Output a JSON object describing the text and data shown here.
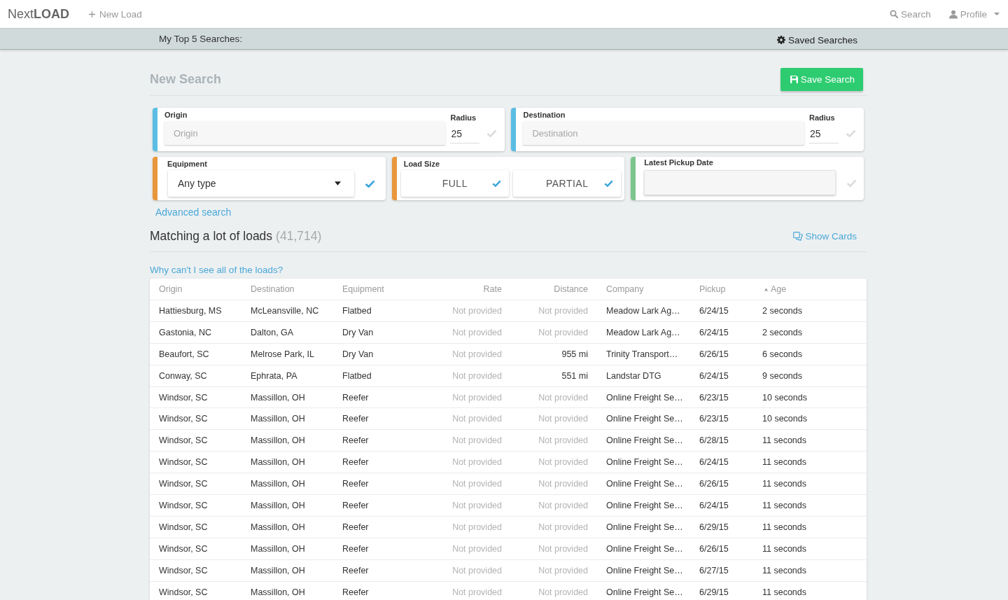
{
  "nav": {
    "logo": "Next**LOAD**",
    "new_load": "New Load",
    "search": "Search",
    "profile": "Profile"
  },
  "top_searches_bar": {
    "label": "My Top 5 Searches:",
    "saved_searches": "Saved Searches"
  },
  "search_form": {
    "title": "New Search",
    "save_button": "Save Search",
    "cards": [
      {
        "kind": "location",
        "color": "#5bbde3",
        "label": "Origin",
        "placeholder": "Origin",
        "radius_label": "Radius",
        "radius": "25",
        "checked": false
      },
      {
        "kind": "location",
        "color": "#5bbde3",
        "label": "Destination",
        "placeholder": "Destination",
        "radius_label": "Radius",
        "radius": "25",
        "checked": false
      },
      {
        "kind": "select",
        "color": "#e8973c",
        "label": "Equipment",
        "value": "Any type",
        "checked": true
      },
      {
        "kind": "toggles",
        "color": "#e8973c",
        "label": "Load Size",
        "options": [
          {
            "label": "FULL",
            "checked": true
          },
          {
            "label": "PARTIAL",
            "checked": true
          }
        ]
      },
      {
        "kind": "date",
        "color": "#7cc58e",
        "label": "Latest Pickup Date",
        "checked": false
      }
    ],
    "advanced_link": "Advanced search"
  },
  "results": {
    "title": "Matching a lot of loads",
    "count": "(41,714)",
    "show_cards": "Show Cards",
    "help_link": "Why can't I see all of the loads?"
  },
  "table": {
    "columns": [
      {
        "label": "Origin",
        "sorted": false
      },
      {
        "label": "Destination",
        "sorted": false
      },
      {
        "label": "Equipment",
        "sorted": false
      },
      {
        "label": "Rate",
        "sorted": false
      },
      {
        "label": "Distance",
        "sorted": false
      },
      {
        "label": "Company",
        "sorted": false
      },
      {
        "label": "Pickup",
        "sorted": false
      },
      {
        "label": "Age",
        "sorted": true
      }
    ],
    "rows": [
      {
        "origin": "Hattiesburg, MS",
        "destination": "McLeansville, NC",
        "equipment": "Flatbed",
        "rate": {
          "text": "Not provided",
          "muted": true
        },
        "distance": {
          "text": "Not provided",
          "muted": true
        },
        "company": "Meadow Lark Ag…",
        "pickup": "6/24/15",
        "age": "2 seconds"
      },
      {
        "origin": "Gastonia, NC",
        "destination": "Dalton, GA",
        "equipment": "Dry Van",
        "rate": {
          "text": "Not provided",
          "muted": true
        },
        "distance": {
          "text": "Not provided",
          "muted": true
        },
        "company": "Meadow Lark Ag…",
        "pickup": "6/24/15",
        "age": "2 seconds"
      },
      {
        "origin": "Beaufort, SC",
        "destination": "Melrose Park, IL",
        "equipment": "Dry Van",
        "rate": {
          "text": "Not provided",
          "muted": true
        },
        "distance": {
          "text": "955 mi",
          "muted": false
        },
        "company": "Trinity Transport…",
        "pickup": "6/26/15",
        "age": "6 seconds"
      },
      {
        "origin": "Conway, SC",
        "destination": "Ephrata, PA",
        "equipment": "Flatbed",
        "rate": {
          "text": "Not provided",
          "muted": true
        },
        "distance": {
          "text": "551 mi",
          "muted": false
        },
        "company": "Landstar DTG",
        "pickup": "6/24/15",
        "age": "9 seconds"
      },
      {
        "origin": "Windsor, SC",
        "destination": "Massillon, OH",
        "equipment": "Reefer",
        "rate": {
          "text": "Not provided",
          "muted": true
        },
        "distance": {
          "text": "Not provided",
          "muted": true
        },
        "company": "Online Freight Se…",
        "pickup": "6/23/15",
        "age": "10 seconds"
      },
      {
        "origin": "Windsor, SC",
        "destination": "Massillon, OH",
        "equipment": "Reefer",
        "rate": {
          "text": "Not provided",
          "muted": true
        },
        "distance": {
          "text": "Not provided",
          "muted": true
        },
        "company": "Online Freight Se…",
        "pickup": "6/23/15",
        "age": "10 seconds"
      },
      {
        "origin": "Windsor, SC",
        "destination": "Massillon, OH",
        "equipment": "Reefer",
        "rate": {
          "text": "Not provided",
          "muted": true
        },
        "distance": {
          "text": "Not provided",
          "muted": true
        },
        "company": "Online Freight Se…",
        "pickup": "6/28/15",
        "age": "11 seconds"
      },
      {
        "origin": "Windsor, SC",
        "destination": "Massillon, OH",
        "equipment": "Reefer",
        "rate": {
          "text": "Not provided",
          "muted": true
        },
        "distance": {
          "text": "Not provided",
          "muted": true
        },
        "company": "Online Freight Se…",
        "pickup": "6/24/15",
        "age": "11 seconds"
      },
      {
        "origin": "Windsor, SC",
        "destination": "Massillon, OH",
        "equipment": "Reefer",
        "rate": {
          "text": "Not provided",
          "muted": true
        },
        "distance": {
          "text": "Not provided",
          "muted": true
        },
        "company": "Online Freight Se…",
        "pickup": "6/26/15",
        "age": "11 seconds"
      },
      {
        "origin": "Windsor, SC",
        "destination": "Massillon, OH",
        "equipment": "Reefer",
        "rate": {
          "text": "Not provided",
          "muted": true
        },
        "distance": {
          "text": "Not provided",
          "muted": true
        },
        "company": "Online Freight Se…",
        "pickup": "6/24/15",
        "age": "11 seconds"
      },
      {
        "origin": "Windsor, SC",
        "destination": "Massillon, OH",
        "equipment": "Reefer",
        "rate": {
          "text": "Not provided",
          "muted": true
        },
        "distance": {
          "text": "Not provided",
          "muted": true
        },
        "company": "Online Freight Se…",
        "pickup": "6/29/15",
        "age": "11 seconds"
      },
      {
        "origin": "Windsor, SC",
        "destination": "Massillon, OH",
        "equipment": "Reefer",
        "rate": {
          "text": "Not provided",
          "muted": true
        },
        "distance": {
          "text": "Not provided",
          "muted": true
        },
        "company": "Online Freight Se…",
        "pickup": "6/26/15",
        "age": "11 seconds"
      },
      {
        "origin": "Windsor, SC",
        "destination": "Massillon, OH",
        "equipment": "Reefer",
        "rate": {
          "text": "Not provided",
          "muted": true
        },
        "distance": {
          "text": "Not provided",
          "muted": true
        },
        "company": "Online Freight Se…",
        "pickup": "6/27/15",
        "age": "11 seconds"
      },
      {
        "origin": "Windsor, SC",
        "destination": "Massillon, OH",
        "equipment": "Reefer",
        "rate": {
          "text": "Not provided",
          "muted": true
        },
        "distance": {
          "text": "Not provided",
          "muted": true
        },
        "company": "Online Freight Se…",
        "pickup": "6/29/15",
        "age": "11 seconds"
      }
    ]
  }
}
